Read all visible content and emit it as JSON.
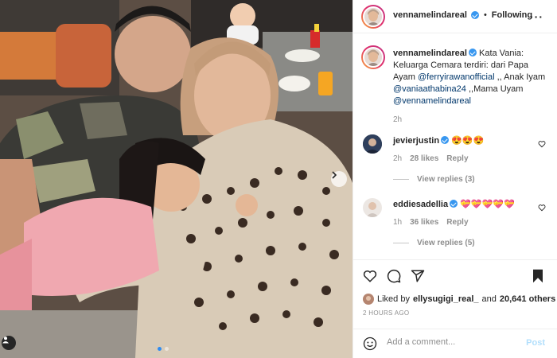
{
  "post": {
    "author": "vennamelindareal",
    "follow_status": "Following",
    "more_icon": "more-horizontal-icon",
    "caption": {
      "username": "vennamelindareal",
      "text_1": "Kata Vania: Keluarga Cemara terdiri: dari Papa Ayam",
      "mention_1": "@ferryirawanofficial",
      "text_2": ",, Anak Iyam",
      "mention_2": "@vaniaathabina24",
      "text_3": ",,Mama Uyam",
      "mention_3": "@vennamelindareal",
      "time": "2h"
    },
    "comments": [
      {
        "username": "jevierjustin",
        "verified": true,
        "text": "😍😍😍",
        "time": "2h",
        "likes": "28 likes",
        "reply_label": "Reply",
        "view_replies": "View replies (3)"
      },
      {
        "username": "eddiesadellia",
        "verified": true,
        "text": "💝💝💝💝💝",
        "time": "1h",
        "likes": "36 likes",
        "reply_label": "Reply",
        "view_replies": "View replies (5)"
      }
    ],
    "liked_by": {
      "prefix": "Liked by",
      "user": "ellysugigi_real_",
      "connector": "and",
      "others": "20,641 others"
    },
    "timestamp": "2 HOURS AGO",
    "comment_box": {
      "placeholder": "Add a comment...",
      "post_label": "Post"
    },
    "carousel": {
      "slides": 2,
      "active": 1
    }
  },
  "colors": {
    "verified": "#3897f0",
    "link": "#00376b",
    "muted": "#8e8e8e",
    "post_disabled": "#b2dffc",
    "carousel_active": "#2f8cf2"
  }
}
